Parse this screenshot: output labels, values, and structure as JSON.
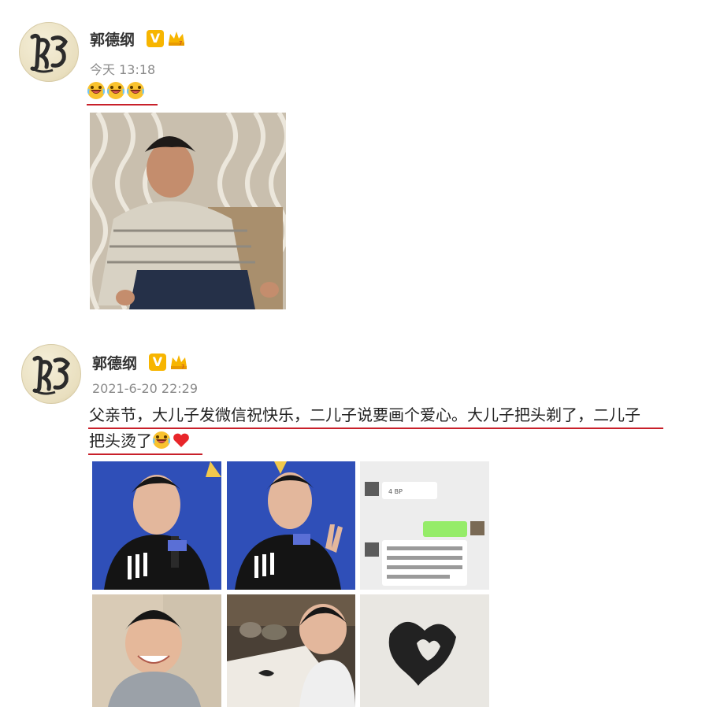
{
  "posts": [
    {
      "author": "郭德纲",
      "time": "今天 13:18",
      "text": "",
      "emojis": [
        "laugh-cry-emoji",
        "laugh-cry-emoji",
        "laugh-cry-emoji"
      ]
    },
    {
      "author": "郭德纲",
      "time": "2021-6-20 22:29",
      "text_line1": "父亲节，大儿子发微信祝快乐，二儿子说要画个爱心。大儿子把头剃了，二儿子",
      "text_line2": "把头烫了",
      "emojis": [
        "laugh-cry-emoji",
        "heart-emoji"
      ]
    }
  ],
  "badges": {
    "verified": "V"
  },
  "colors": {
    "underline": "#c8202a",
    "verified": "#f7b500",
    "time": "#8a8a8a"
  },
  "chat": {
    "bubble_left": "4 BP",
    "message": "好啊啊，我们还在平谷亲节日呢，明天最后一天，你爸爸在北京没回家儿，他后天"
  }
}
